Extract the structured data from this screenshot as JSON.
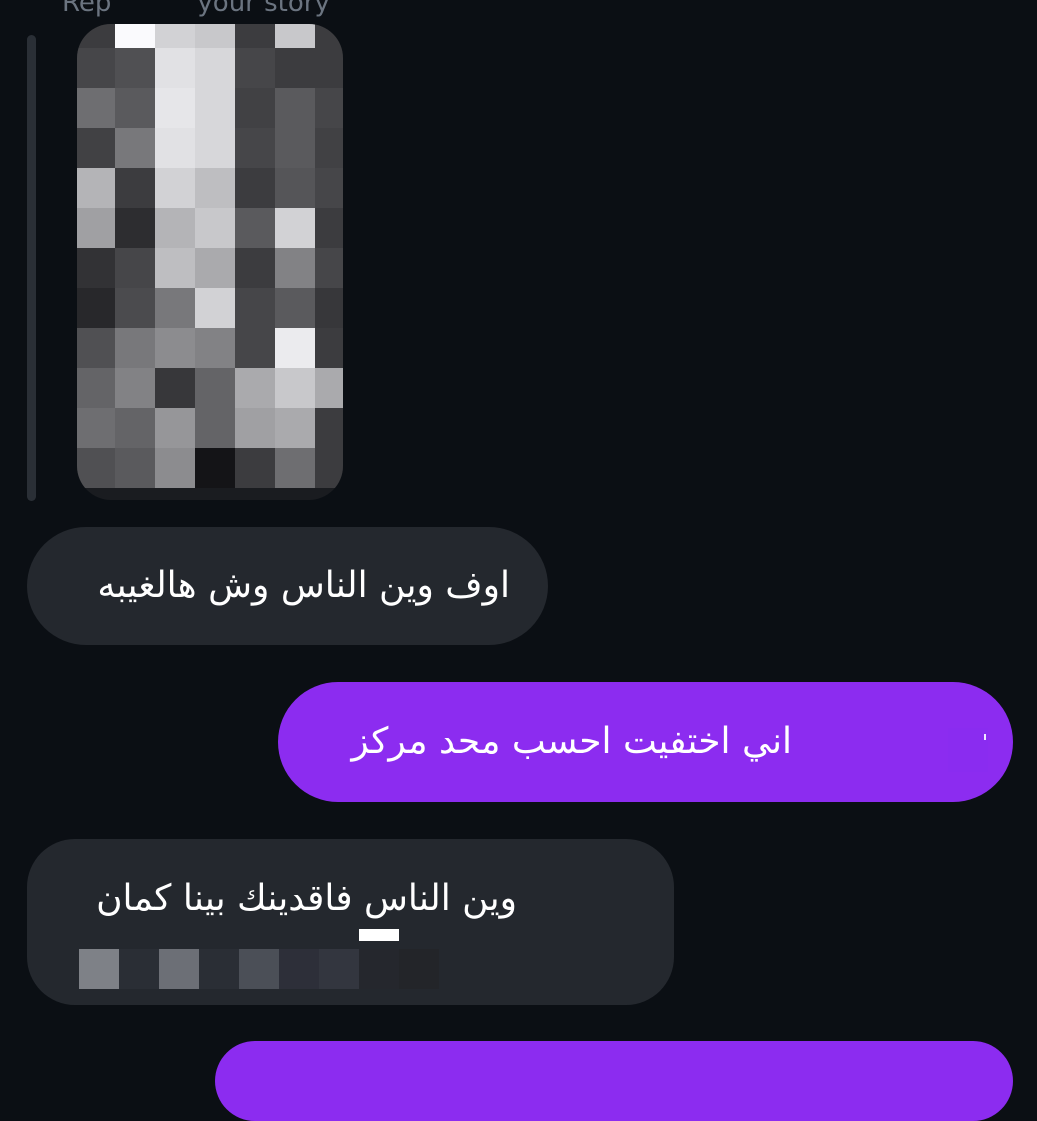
{
  "reply_header": {
    "prefix": "Rep",
    "suffix": "your story"
  },
  "story_thumbnail": {
    "icon": "redacted-story-image"
  },
  "messages": [
    {
      "direction": "received",
      "text": "اوف وين الناس وش هالغيبه"
    },
    {
      "direction": "sent",
      "text": "اني اختفيت احسب محد مركز"
    },
    {
      "direction": "received",
      "text": "وين الناس فاقدينك بينا كمان"
    },
    {
      "direction": "sent",
      "text": ""
    }
  ],
  "colors": {
    "background": "#0b0f14",
    "received_bubble": "#24282e",
    "sent_bubble": "#8c2cf0",
    "text": "#ffffff",
    "reply_header": "#6b7480"
  }
}
